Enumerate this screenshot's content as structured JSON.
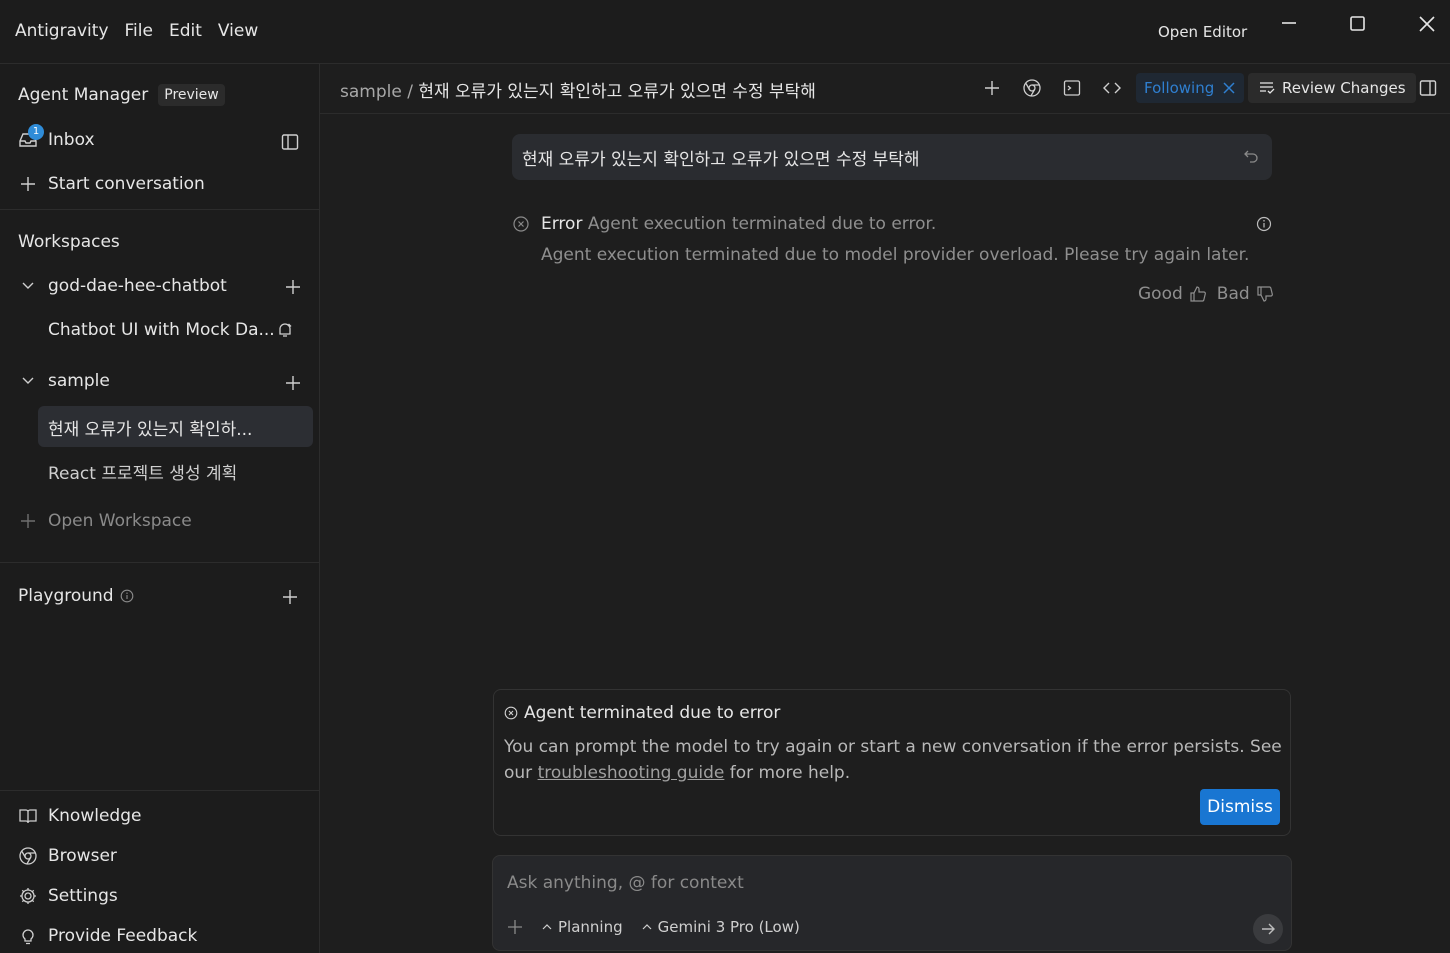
{
  "titlebar": {
    "menu": [
      "Antigravity",
      "File",
      "Edit",
      "View"
    ],
    "open_editor": "Open Editor"
  },
  "sidebar": {
    "agent_manager": "Agent Manager",
    "preview": "Preview",
    "inbox": "Inbox",
    "inbox_badge": "1",
    "start_conversation": "Start conversation",
    "workspaces_header": "Workspaces",
    "workspaces": [
      {
        "name": "god-dae-hee-chatbot",
        "conversations": [
          "Chatbot UI with Mock Da..."
        ]
      },
      {
        "name": "sample",
        "conversations": [
          "현재 오류가 있는지 확인하...",
          "React 프로젝트 생성 계획"
        ]
      }
    ],
    "open_workspace": "Open Workspace",
    "playground": "Playground",
    "bottom": {
      "knowledge": "Knowledge",
      "browser": "Browser",
      "settings": "Settings",
      "feedback": "Provide Feedback"
    }
  },
  "header": {
    "workspace": "sample",
    "separator": "/",
    "title": "현재 오류가 있는지 확인하고 오류가 있으면 수정 부탁해",
    "following": "Following",
    "review_changes": "Review Changes"
  },
  "chat": {
    "user_message": "현재 오류가 있는지 확인하고 오류가 있으면 수정 부탁해",
    "error_label": "Error",
    "error_summary": "Agent execution terminated due to error.",
    "error_detail": "Agent execution terminated due to model provider overload. Please try again later.",
    "good": "Good",
    "bad": "Bad"
  },
  "error_panel": {
    "title": "Agent terminated due to error",
    "body_before": "You can prompt the model to try again or start a new conversation if the error persists. See our ",
    "link": "troubleshooting guide",
    "body_after": " for more help.",
    "dismiss": "Dismiss"
  },
  "input": {
    "placeholder": "Ask anything, @ for context",
    "mode": "Planning",
    "model": "Gemini 3 Pro (Low)"
  },
  "colors": {
    "accent": "#1976d2",
    "following": "#2f7fd0",
    "badge": "#2f8cd8"
  }
}
